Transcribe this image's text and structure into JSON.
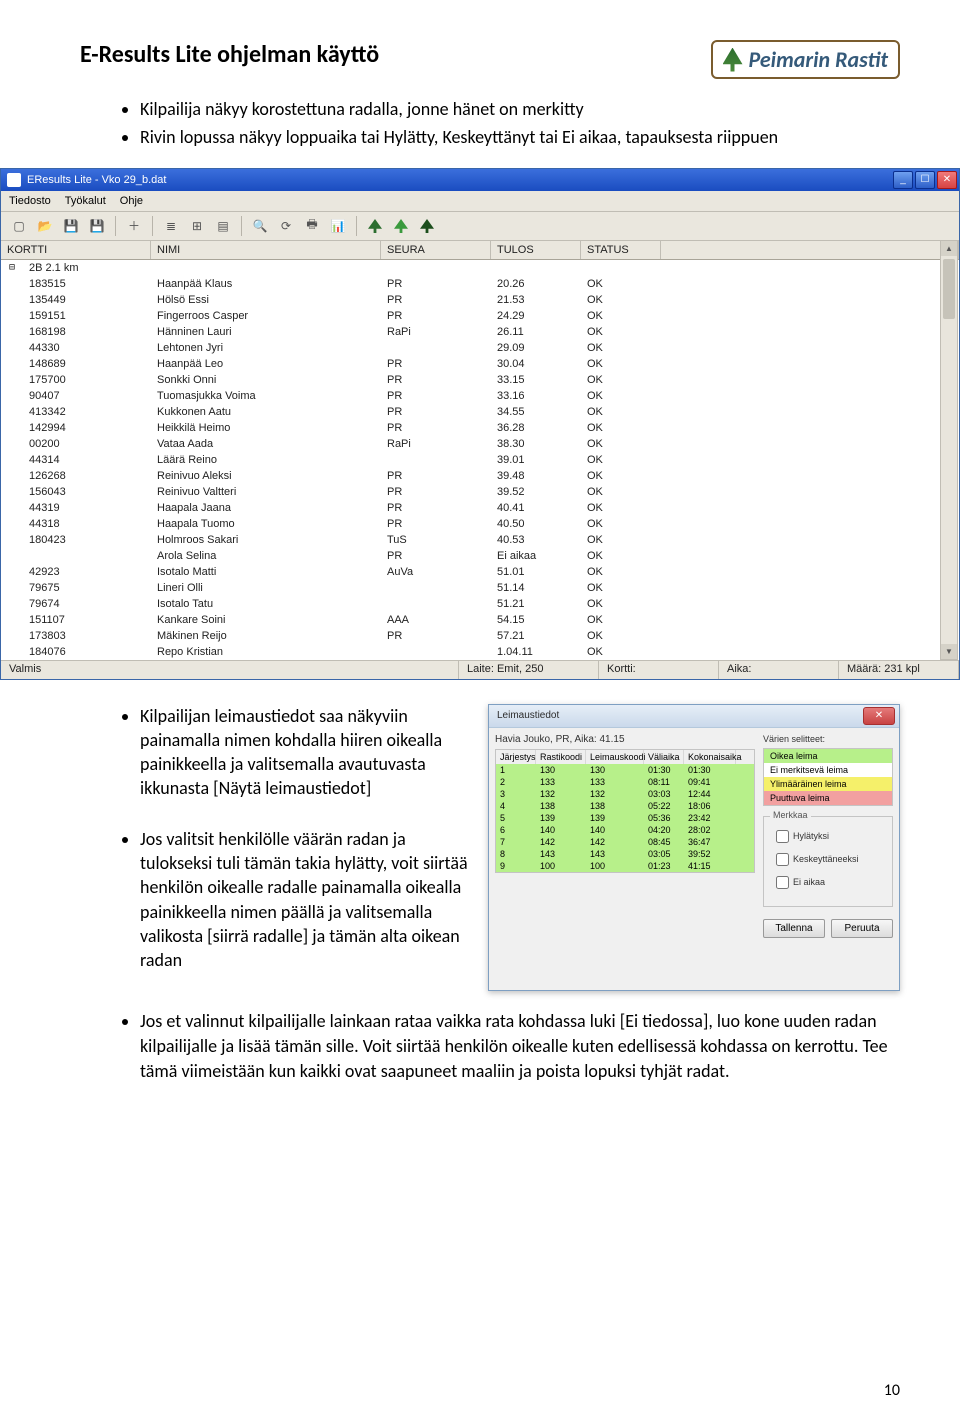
{
  "title": "E-Results Lite ohjelman käyttö",
  "brand": "Peimarin Rastit",
  "intro_bullets": [
    "Kilpailija näkyy korostettuna radalla, jonne hänet on merkitty",
    "Rivin lopussa näkyy loppuaika tai Hylätty, Keskeyttänyt tai Ei aikaa, tapauksesta riippuen"
  ],
  "app_window": {
    "title": "EResults Lite - Vko 29_b.dat",
    "menu": [
      "Tiedosto",
      "Työkalut",
      "Ohje"
    ],
    "columns": [
      "KORTTI",
      "NIMI",
      "SEURA",
      "TULOS",
      "STATUS"
    ],
    "group": "2B 2.1 km",
    "rows": [
      {
        "kortti": "183515",
        "nimi": "Haanpää Klaus",
        "seura": "PR",
        "tulos": "20.26",
        "status": "OK"
      },
      {
        "kortti": "135449",
        "nimi": "Hölsö Essi",
        "seura": "PR",
        "tulos": "21.53",
        "status": "OK"
      },
      {
        "kortti": "159151",
        "nimi": "Fingerroos Casper",
        "seura": "PR",
        "tulos": "24.29",
        "status": "OK"
      },
      {
        "kortti": "168198",
        "nimi": "Hänninen Lauri",
        "seura": "RaPi",
        "tulos": "26.11",
        "status": "OK"
      },
      {
        "kortti": "44330",
        "nimi": "Lehtonen Jyri",
        "seura": "",
        "tulos": "29.09",
        "status": "OK"
      },
      {
        "kortti": "148689",
        "nimi": "Haanpää Leo",
        "seura": "PR",
        "tulos": "30.04",
        "status": "OK"
      },
      {
        "kortti": "175700",
        "nimi": "Sonkki Onni",
        "seura": "PR",
        "tulos": "33.15",
        "status": "OK"
      },
      {
        "kortti": "90407",
        "nimi": "Tuomasjukka Voima",
        "seura": "PR",
        "tulos": "33.16",
        "status": "OK"
      },
      {
        "kortti": "413342",
        "nimi": "Kukkonen Aatu",
        "seura": "PR",
        "tulos": "34.55",
        "status": "OK"
      },
      {
        "kortti": "142994",
        "nimi": "Heikkilä Heimo",
        "seura": "PR",
        "tulos": "36.28",
        "status": "OK"
      },
      {
        "kortti": "00200",
        "nimi": "Vataa Aada",
        "seura": "RaPi",
        "tulos": "38.30",
        "status": "OK"
      },
      {
        "kortti": "44314",
        "nimi": "Läärä Reino",
        "seura": "",
        "tulos": "39.01",
        "status": "OK"
      },
      {
        "kortti": "126268",
        "nimi": "Reinivuo Aleksi",
        "seura": "PR",
        "tulos": "39.48",
        "status": "OK"
      },
      {
        "kortti": "156043",
        "nimi": "Reinivuo Valtteri",
        "seura": "PR",
        "tulos": "39.52",
        "status": "OK"
      },
      {
        "kortti": "44319",
        "nimi": "Haapala Jaana",
        "seura": "PR",
        "tulos": "40.41",
        "status": "OK"
      },
      {
        "kortti": "44318",
        "nimi": "Haapala Tuomo",
        "seura": "PR",
        "tulos": "40.50",
        "status": "OK"
      },
      {
        "kortti": "180423",
        "nimi": "Holmroos Sakari",
        "seura": "TuS",
        "tulos": "40.53",
        "status": "OK"
      },
      {
        "kortti": "",
        "nimi": "Arola Selina",
        "seura": "PR",
        "tulos": "Ei aikaa",
        "status": "OK"
      },
      {
        "kortti": "42923",
        "nimi": "Isotalo Matti",
        "seura": "AuVa",
        "tulos": "51.01",
        "status": "OK"
      },
      {
        "kortti": "79675",
        "nimi": "Lineri Olli",
        "seura": "",
        "tulos": "51.14",
        "status": "OK"
      },
      {
        "kortti": "79674",
        "nimi": "Isotalo Tatu",
        "seura": "",
        "tulos": "51.21",
        "status": "OK"
      },
      {
        "kortti": "151107",
        "nimi": "Kankare Soini",
        "seura": "AAA",
        "tulos": "54.15",
        "status": "OK"
      },
      {
        "kortti": "173803",
        "nimi": "Mäkinen Reijo",
        "seura": "PR",
        "tulos": "57.21",
        "status": "OK"
      },
      {
        "kortti": "184076",
        "nimi": "Repo Kristian",
        "seura": "",
        "tulos": "1.04.11",
        "status": "OK"
      }
    ],
    "status": {
      "ready": "Valmis",
      "laite": "Laite: Emit, 250",
      "kortti": "Kortti:",
      "aika": "Aika:",
      "maara": "Määrä: 231 kpl"
    }
  },
  "section2_bullets": [
    "Kilpailijan leimaustiedot saa näkyviin painamalla nimen kohdalla hiiren oikealla painikkeella ja valitsemalla avautuvasta ikkunasta [Näytä leimaustiedot]",
    "Jos valitsit henkilölle väärän radan ja tulokseksi tuli tämän takia hylätty, voit siirtää henkilön oikealle radalle painamalla oikealla painikkeella nimen päällä ja valitsemalla valikosta [siirrä radalle] ja tämän alta oikean radan"
  ],
  "dialog": {
    "title": "Leimaustiedot",
    "subtitle": "Havia Jouko, PR, Aika: 41.15",
    "table_head": [
      "Järjestys",
      "Rastikoodi",
      "Leimauskoodi",
      "Väliaika",
      "Kokonaisaika"
    ],
    "rows": [
      {
        "n": "1",
        "c": "130",
        "l": "130",
        "v": "01:30",
        "k": "01:30"
      },
      {
        "n": "2",
        "c": "133",
        "l": "133",
        "v": "08:11",
        "k": "09:41"
      },
      {
        "n": "3",
        "c": "132",
        "l": "132",
        "v": "03:03",
        "k": "12:44"
      },
      {
        "n": "4",
        "c": "138",
        "l": "138",
        "v": "05:22",
        "k": "18:06"
      },
      {
        "n": "5",
        "c": "139",
        "l": "139",
        "v": "05:36",
        "k": "23:42"
      },
      {
        "n": "6",
        "c": "140",
        "l": "140",
        "v": "04:20",
        "k": "28:02"
      },
      {
        "n": "7",
        "c": "142",
        "l": "142",
        "v": "08:45",
        "k": "36:47"
      },
      {
        "n": "8",
        "c": "143",
        "l": "143",
        "v": "03:05",
        "k": "39:52"
      },
      {
        "n": "9",
        "c": "100",
        "l": "100",
        "v": "01:23",
        "k": "41:15"
      }
    ],
    "legend_title": "Värien selitteet:",
    "legend": [
      {
        "cls": "lg1",
        "selite": "Oikea leima"
      },
      {
        "cls": "lg2",
        "selite": "Ei merkitsevä leima"
      },
      {
        "cls": "lg3",
        "selite": "Ylimääräinen leima"
      },
      {
        "cls": "lg4",
        "selite": "Puuttuva leima"
      }
    ],
    "merkkaa": {
      "title": "Merkkaa",
      "opts": [
        "Hylätyksi",
        "Keskeyttäneeksi",
        "Ei aikaa"
      ]
    },
    "btn_save": "Tallenna",
    "btn_cancel": "Peruuta"
  },
  "final_bullets": [
    "Jos et valinnut kilpailijalle lainkaan rataa vaikka rata kohdassa luki [Ei tiedossa], luo kone uuden radan kilpailijalle ja lisää tämän sille. Voit siirtää henkilön oikealle kuten edellisessä kohdassa on kerrottu. Tee tämä viimeistään kun kaikki ovat saapuneet maaliin ja poista lopuksi tyhjät radat."
  ],
  "page_num": "10"
}
